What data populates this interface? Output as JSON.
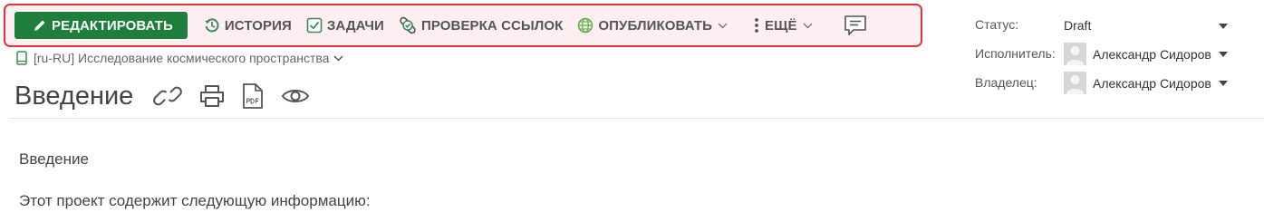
{
  "toolbar": {
    "edit_label": "РЕДАКТИРОВАТЬ",
    "history_label": "ИСТОРИЯ",
    "tasks_label": "ЗАДАЧИ",
    "link_check_label": "ПРОВЕРКА ССЫЛОК",
    "publish_label": "ОПУБЛИКОВАТЬ",
    "more_label": "ЕЩЁ"
  },
  "breadcrumb": {
    "project": "[ru-RU] Исследование космического пространства"
  },
  "page": {
    "title": "Введение"
  },
  "content": {
    "heading": "Введение",
    "paragraph": "Этот проект содержит следующую информацию:"
  },
  "properties": {
    "status_label": "Статус:",
    "status_value": "Draft",
    "assignee_label": "Исполнитель:",
    "assignee_value": "Александр Сидоров",
    "owner_label": "Владелец:",
    "owner_value": "Александр Сидоров"
  },
  "colors": {
    "edit_button": "#1e7e3b",
    "toolbar_bg": "#fdeef2",
    "toolbar_border": "#e0343a",
    "history_icon": "#3d8a5a",
    "tasks_icon": "#3d8a5a",
    "link_check_icon": "#3d8a5a",
    "publish_icon": "#6aa84f",
    "breadcrumb_icon": "#3d8a5a"
  },
  "icons": {
    "edit": "pencil-icon",
    "history": "history-icon",
    "tasks": "checkbox-icon",
    "link_check": "link-check-icon",
    "publish": "globe-icon",
    "more": "vertical-dots-icon",
    "comments": "comment-icon",
    "breadcrumb": "book-icon",
    "title_actions": [
      "link-icon",
      "print-icon",
      "pdf-icon",
      "eye-icon"
    ]
  }
}
